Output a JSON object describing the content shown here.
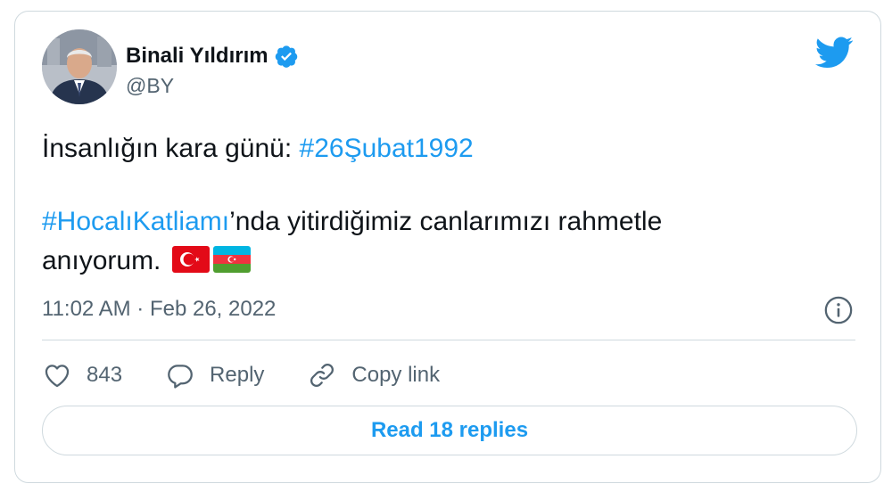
{
  "author": {
    "name": "Binali Yıldırım",
    "handle": "@BY",
    "verified": true
  },
  "tweet": {
    "line1_text": "İnsanlığın kara günü: ",
    "line1_hashtag": "#26Şubat1992",
    "line2_hashtag": "#HocalıKatliamı",
    "line2_text": "’nda yitirdiğimiz canlarımızı rahmetle",
    "line3_text": "anıyorum.",
    "flags": [
      "turkey-flag",
      "azerbaijan-flag"
    ]
  },
  "meta": {
    "timestamp": "11:02 AM · Feb 26, 2022"
  },
  "actions": {
    "like_count": "843",
    "reply_label": "Reply",
    "copy_link_label": "Copy link"
  },
  "read_replies_label": "Read 18 replies",
  "colors": {
    "accent": "#1d9bf0",
    "text": "#0f1419",
    "secondary": "#536471",
    "border": "#cfd9de"
  },
  "icons": {
    "logo": "twitter-bird-icon",
    "verified": "verified-badge-icon",
    "info": "info-icon",
    "like": "heart-icon",
    "reply": "speech-bubble-icon",
    "copy_link": "link-icon"
  }
}
